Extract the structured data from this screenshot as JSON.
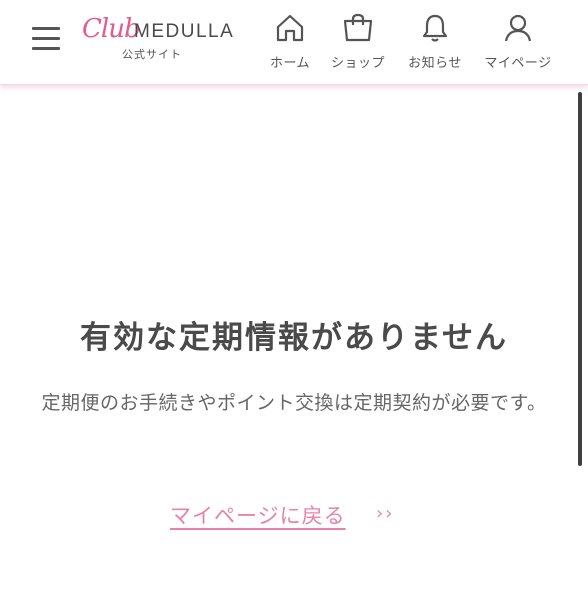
{
  "header": {
    "logo_script": "Club",
    "logo_brand": "MEDULLA",
    "logo_sub": "公式サイト",
    "nav": [
      {
        "label": "ホーム",
        "icon": "home-icon"
      },
      {
        "label": "ショップ",
        "icon": "shopping-bag-icon"
      },
      {
        "label": "お知らせ",
        "icon": "bell-icon"
      },
      {
        "label": "マイページ",
        "icon": "user-icon"
      }
    ]
  },
  "main": {
    "title": "有効な定期情報がありません",
    "description": "定期便のお手続きやポイント交換は定期契約が必要です。",
    "back_link": "マイページに戻る",
    "back_chevron": "››"
  },
  "colors": {
    "accent_pink": "#e882aa",
    "logo_pink": "#e45a8c",
    "text_dark": "#4a4a4a",
    "text_gray": "#666666"
  }
}
